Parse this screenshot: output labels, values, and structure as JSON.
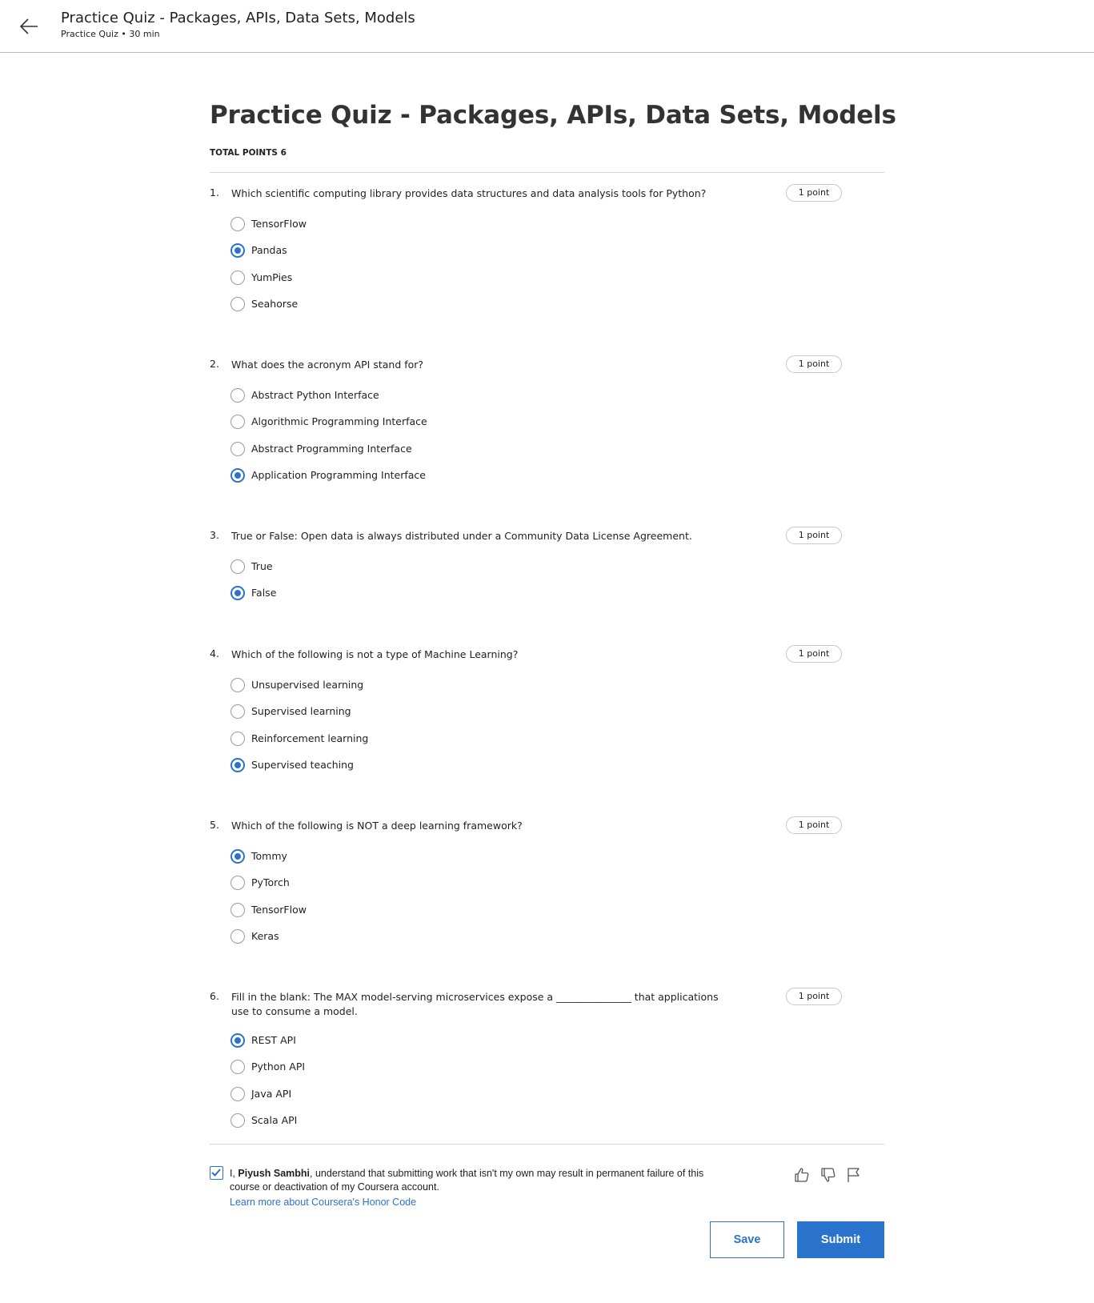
{
  "header": {
    "title": "Practice Quiz - Packages, APIs, Data Sets, Models",
    "subtitle": "Practice Quiz • 30 min",
    "back_icon": "arrow-left-icon"
  },
  "quiz": {
    "title": "Practice Quiz - Packages, APIs, Data Sets, Models",
    "total_points": "TOTAL POINTS 6",
    "questions": [
      {
        "number": "1.",
        "text": "Which scientific computing library provides data structures and data analysis tools for Python?",
        "points": "1 point",
        "options": [
          {
            "label": "TensorFlow",
            "selected": false
          },
          {
            "label": "Pandas",
            "selected": true
          },
          {
            "label": "YumPies",
            "selected": false
          },
          {
            "label": "Seahorse",
            "selected": false
          }
        ]
      },
      {
        "number": "2.",
        "text": "What does the acronym API stand for?",
        "points": "1 point",
        "options": [
          {
            "label": "Abstract Python Interface",
            "selected": false
          },
          {
            "label": "Algorithmic Programming Interface",
            "selected": false
          },
          {
            "label": "Abstract Programming Interface",
            "selected": false
          },
          {
            "label": "Application Programming Interface",
            "selected": true
          }
        ]
      },
      {
        "number": "3.",
        "text": "True or False: Open data is always distributed under a Community Data License Agreement.",
        "points": "1 point",
        "options": [
          {
            "label": "True",
            "selected": false
          },
          {
            "label": "False",
            "selected": true
          }
        ]
      },
      {
        "number": "4.",
        "text": "Which of the following is not a type of Machine Learning?",
        "points": "1 point",
        "options": [
          {
            "label": "Unsupervised learning",
            "selected": false
          },
          {
            "label": "Supervised learning",
            "selected": false
          },
          {
            "label": "Reinforcement learning",
            "selected": false
          },
          {
            "label": "Supervised teaching",
            "selected": true
          }
        ]
      },
      {
        "number": "5.",
        "text": "Which of the following is NOT a deep learning framework?",
        "points": "1 point",
        "options": [
          {
            "label": "Tommy",
            "selected": true
          },
          {
            "label": "PyTorch",
            "selected": false
          },
          {
            "label": "TensorFlow",
            "selected": false
          },
          {
            "label": "Keras",
            "selected": false
          }
        ]
      },
      {
        "number": "6.",
        "text": "Fill in the blank: The MAX model-serving microservices expose a _______________ that applications use to consume a model.",
        "points": "1 point",
        "options": [
          {
            "label": "REST API",
            "selected": true
          },
          {
            "label": "Python API",
            "selected": false
          },
          {
            "label": "Java API",
            "selected": false
          },
          {
            "label": "Scala API",
            "selected": false
          }
        ]
      }
    ]
  },
  "honor": {
    "checked": true,
    "prefix": "I, ",
    "name": "Piyush Sambhi",
    "suffix": ", understand that submitting work that isn't my own may result in permanent failure of this course or deactivation of my Coursera account.",
    "link": "Learn more about Coursera's Honor Code",
    "icons": [
      "thumbs-up-icon",
      "thumbs-down-icon",
      "flag-icon"
    ]
  },
  "actions": {
    "save_label": "Save",
    "submit_label": "Submit"
  },
  "colors": {
    "accent": "#2a73cc",
    "text": "#1f1f1f",
    "title": "#333333"
  }
}
